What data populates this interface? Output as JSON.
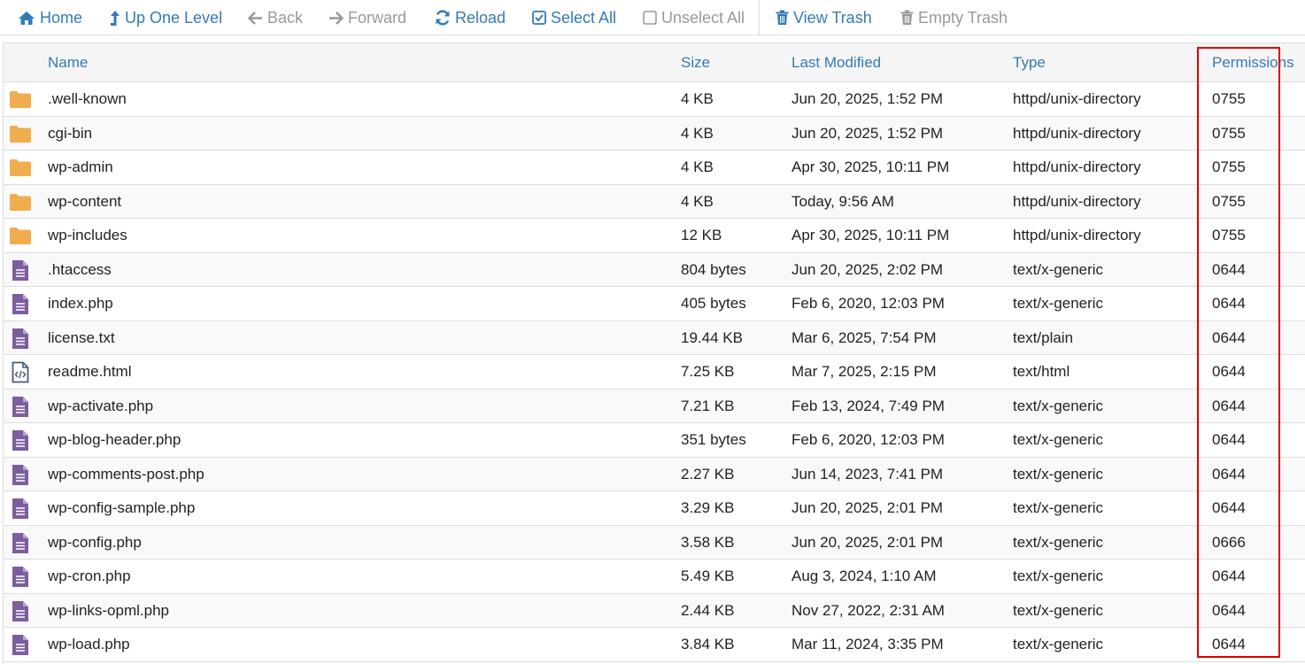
{
  "toolbar": {
    "home": "Home",
    "up_one_level": "Up One Level",
    "back": "Back",
    "forward": "Forward",
    "reload": "Reload",
    "select_all": "Select All",
    "unselect_all": "Unselect All",
    "view_trash": "View Trash",
    "empty_trash": "Empty Trash"
  },
  "table": {
    "headers": {
      "name": "Name",
      "size": "Size",
      "last_modified": "Last Modified",
      "type": "Type",
      "permissions": "Permissions"
    },
    "rows": [
      {
        "icon": "folder-icon",
        "name": ".well-known",
        "size": "4 KB",
        "modified": "Jun 20, 2025, 1:52 PM",
        "type": "httpd/unix-directory",
        "perms": "0755"
      },
      {
        "icon": "folder-icon",
        "name": "cgi-bin",
        "size": "4 KB",
        "modified": "Jun 20, 2025, 1:52 PM",
        "type": "httpd/unix-directory",
        "perms": "0755"
      },
      {
        "icon": "folder-icon",
        "name": "wp-admin",
        "size": "4 KB",
        "modified": "Apr 30, 2025, 10:11 PM",
        "type": "httpd/unix-directory",
        "perms": "0755"
      },
      {
        "icon": "folder-icon",
        "name": "wp-content",
        "size": "4 KB",
        "modified": "Today, 9:56 AM",
        "type": "httpd/unix-directory",
        "perms": "0755"
      },
      {
        "icon": "folder-icon",
        "name": "wp-includes",
        "size": "12 KB",
        "modified": "Apr 30, 2025, 10:11 PM",
        "type": "httpd/unix-directory",
        "perms": "0755"
      },
      {
        "icon": "file-text-icon",
        "name": ".htaccess",
        "size": "804 bytes",
        "modified": "Jun 20, 2025, 2:02 PM",
        "type": "text/x-generic",
        "perms": "0644"
      },
      {
        "icon": "file-text-icon",
        "name": "index.php",
        "size": "405 bytes",
        "modified": "Feb 6, 2020, 12:03 PM",
        "type": "text/x-generic",
        "perms": "0644"
      },
      {
        "icon": "file-text-icon",
        "name": "license.txt",
        "size": "19.44 KB",
        "modified": "Mar 6, 2025, 7:54 PM",
        "type": "text/plain",
        "perms": "0644"
      },
      {
        "icon": "file-code-icon",
        "name": "readme.html",
        "size": "7.25 KB",
        "modified": "Mar 7, 2025, 2:15 PM",
        "type": "text/html",
        "perms": "0644"
      },
      {
        "icon": "file-text-icon",
        "name": "wp-activate.php",
        "size": "7.21 KB",
        "modified": "Feb 13, 2024, 7:49 PM",
        "type": "text/x-generic",
        "perms": "0644"
      },
      {
        "icon": "file-text-icon",
        "name": "wp-blog-header.php",
        "size": "351 bytes",
        "modified": "Feb 6, 2020, 12:03 PM",
        "type": "text/x-generic",
        "perms": "0644"
      },
      {
        "icon": "file-text-icon",
        "name": "wp-comments-post.php",
        "size": "2.27 KB",
        "modified": "Jun 14, 2023, 7:41 PM",
        "type": "text/x-generic",
        "perms": "0644"
      },
      {
        "icon": "file-text-icon",
        "name": "wp-config-sample.php",
        "size": "3.29 KB",
        "modified": "Jun 20, 2025, 2:01 PM",
        "type": "text/x-generic",
        "perms": "0644"
      },
      {
        "icon": "file-text-icon",
        "name": "wp-config.php",
        "size": "3.58 KB",
        "modified": "Jun 20, 2025, 2:01 PM",
        "type": "text/x-generic",
        "perms": "0666"
      },
      {
        "icon": "file-text-icon",
        "name": "wp-cron.php",
        "size": "5.49 KB",
        "modified": "Aug 3, 2024, 1:10 AM",
        "type": "text/x-generic",
        "perms": "0644"
      },
      {
        "icon": "file-text-icon",
        "name": "wp-links-opml.php",
        "size": "2.44 KB",
        "modified": "Nov 27, 2022, 2:31 AM",
        "type": "text/x-generic",
        "perms": "0644"
      },
      {
        "icon": "file-text-icon",
        "name": "wp-load.php",
        "size": "3.84 KB",
        "modified": "Mar 11, 2024, 3:35 PM",
        "type": "text/x-generic",
        "perms": "0644"
      }
    ]
  },
  "colors": {
    "link_blue": "#337ab7",
    "folder": "#f0ad4e",
    "file": "#7b5e9e",
    "highlight_red": "#e00000"
  }
}
